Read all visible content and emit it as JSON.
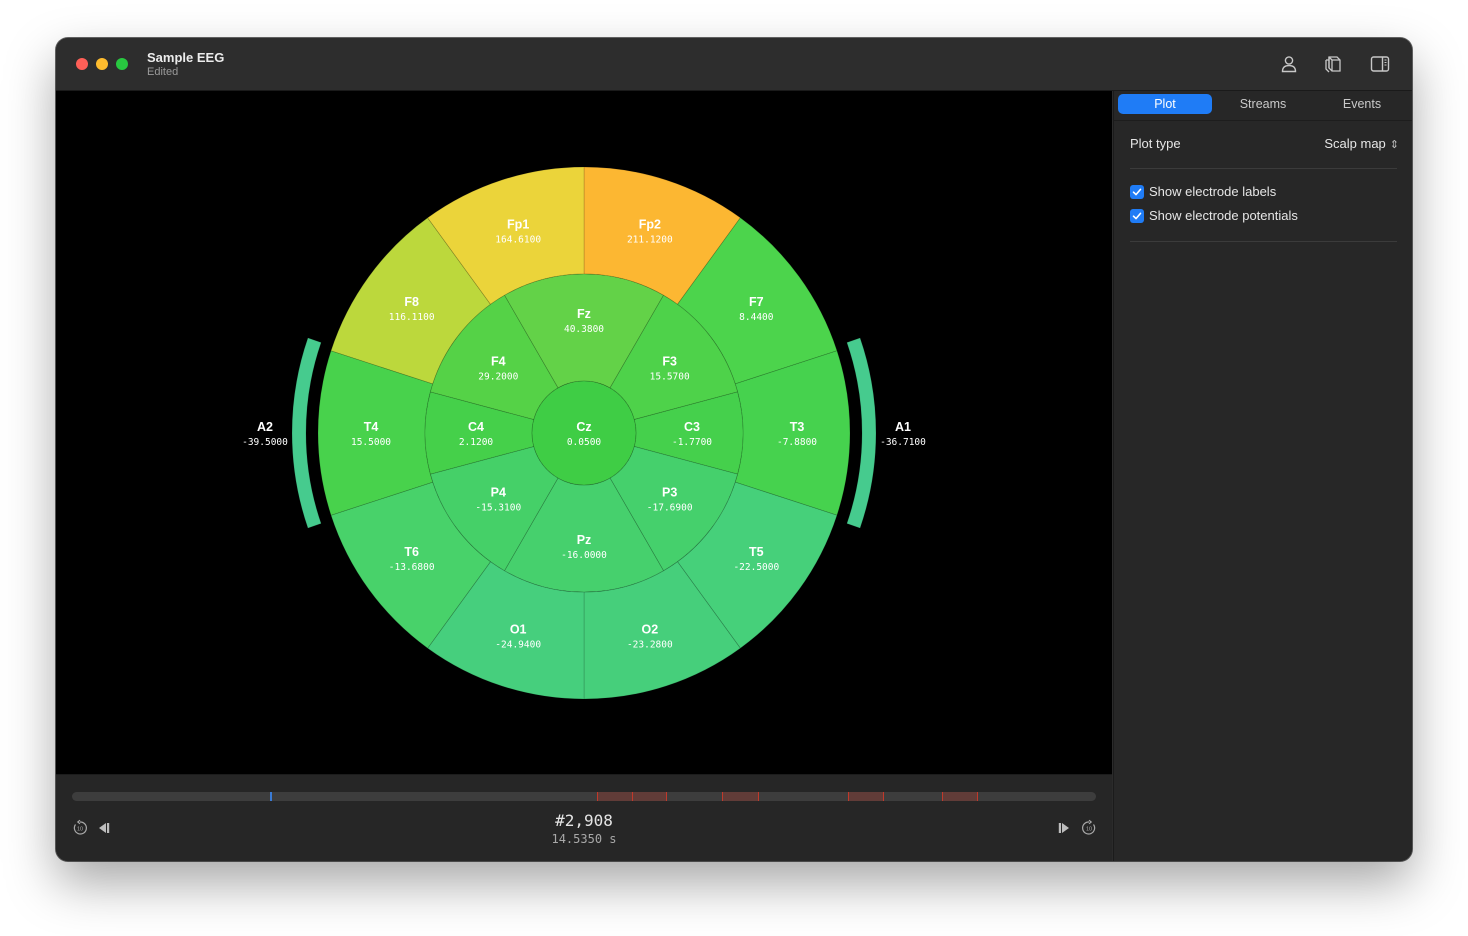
{
  "window": {
    "title": "Sample EEG",
    "subtitle": "Edited"
  },
  "toolbar": {
    "icons": [
      "person-icon",
      "cube-stack-icon",
      "sidebar-toggle-icon"
    ]
  },
  "sidebar": {
    "tabs": [
      {
        "label": "Plot",
        "active": true
      },
      {
        "label": "Streams",
        "active": false
      },
      {
        "label": "Events",
        "active": false
      }
    ],
    "plot_type": {
      "label": "Plot type",
      "value": "Scalp map"
    },
    "checkboxes": [
      {
        "label": "Show electrode labels",
        "checked": true
      },
      {
        "label": "Show electrode potentials",
        "checked": true
      }
    ]
  },
  "scalp_map": {
    "electrodes": [
      {
        "id": "Fp1",
        "value": "164.6100",
        "color": "#ebd43a"
      },
      {
        "id": "Fp2",
        "value": "211.1200",
        "color": "#fcb732"
      },
      {
        "id": "F8",
        "value": "116.1100",
        "color": "#bcd83c"
      },
      {
        "id": "F7",
        "value": "8.4400",
        "color": "#4cd44c"
      },
      {
        "id": "T4",
        "value": "15.5000",
        "color": "#48d24c"
      },
      {
        "id": "T3",
        "value": "-7.8800",
        "color": "#46d24e"
      },
      {
        "id": "T6",
        "value": "-13.6800",
        "color": "#48d26a"
      },
      {
        "id": "T5",
        "value": "-22.5000",
        "color": "#46d07a"
      },
      {
        "id": "O1",
        "value": "-24.9400",
        "color": "#46cf7d"
      },
      {
        "id": "O2",
        "value": "-23.2800",
        "color": "#46cf7b"
      },
      {
        "id": "Fz",
        "value": "40.3800",
        "color": "#63d248"
      },
      {
        "id": "F4",
        "value": "29.2000",
        "color": "#55d247"
      },
      {
        "id": "F3",
        "value": "15.5700",
        "color": "#4ed24a"
      },
      {
        "id": "C4",
        "value": "2.1200",
        "color": "#45d04a"
      },
      {
        "id": "C3",
        "value": "-1.7700",
        "color": "#45d04c"
      },
      {
        "id": "Cz",
        "value": "0.0500",
        "color": "#3fcd45"
      },
      {
        "id": "P4",
        "value": "-15.3100",
        "color": "#45d068"
      },
      {
        "id": "P3",
        "value": "-17.6900",
        "color": "#45d06c"
      },
      {
        "id": "Pz",
        "value": "-16.0000",
        "color": "#46d06d"
      },
      {
        "id": "A2",
        "value": "-39.5000",
        "color": "#46cb8e"
      },
      {
        "id": "A1",
        "value": "-36.7100",
        "color": "#46cb8e"
      }
    ]
  },
  "timeline": {
    "frame": "#2,908",
    "time": "14.5350 s",
    "playhead_fraction": 0.193,
    "event_ranges": [
      [
        0.513,
        0.58
      ],
      [
        0.635,
        0.67
      ],
      [
        0.758,
        0.792
      ],
      [
        0.85,
        0.884
      ]
    ],
    "event_marks": [
      0.513,
      0.547,
      0.58,
      0.635,
      0.67,
      0.758,
      0.792,
      0.85,
      0.884
    ],
    "accent": "#3a7bd5",
    "event_color": "#c0392b"
  },
  "transport_icons": [
    "rewind-10-icon",
    "step-back-icon",
    "step-forward-icon",
    "forward-10-icon"
  ]
}
